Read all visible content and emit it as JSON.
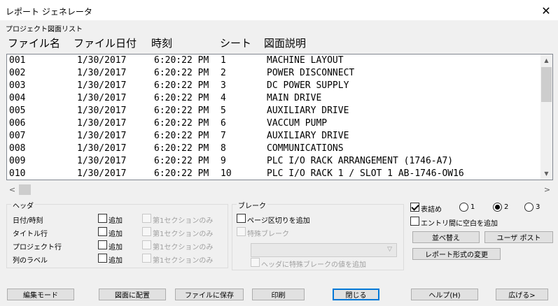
{
  "window": {
    "title": "レポート ジェネレータ",
    "close_glyph": "✕"
  },
  "list": {
    "caption": "プロジェクト図面リスト",
    "columns": {
      "file": "ファイル名",
      "date": "ファイル日付",
      "time": "時刻",
      "sheet": "シート",
      "desc": "図面説明"
    },
    "rows": [
      {
        "file": "001",
        "date": "1/30/2017",
        "time": "6:20:22 PM",
        "sheet": "1",
        "desc": "MACHINE LAYOUT"
      },
      {
        "file": "002",
        "date": "1/30/2017",
        "time": "6:20:22 PM",
        "sheet": "2",
        "desc": "POWER DISCONNECT"
      },
      {
        "file": "003",
        "date": "1/30/2017",
        "time": "6:20:22 PM",
        "sheet": "3",
        "desc": "DC POWER SUPPLY"
      },
      {
        "file": "004",
        "date": "1/30/2017",
        "time": "6:20:22 PM",
        "sheet": "4",
        "desc": "MAIN DRIVE"
      },
      {
        "file": "005",
        "date": "1/30/2017",
        "time": "6:20:22 PM",
        "sheet": "5",
        "desc": "AUXILIARY DRIVE"
      },
      {
        "file": "006",
        "date": "1/30/2017",
        "time": "6:20:22 PM",
        "sheet": "6",
        "desc": "VACCUM PUMP"
      },
      {
        "file": "007",
        "date": "1/30/2017",
        "time": "6:20:22 PM",
        "sheet": "7",
        "desc": "AUXILIARY DRIVE"
      },
      {
        "file": "008",
        "date": "1/30/2017",
        "time": "6:20:22 PM",
        "sheet": "8",
        "desc": "COMMUNICATIONS"
      },
      {
        "file": "009",
        "date": "1/30/2017",
        "time": "6:20:22 PM",
        "sheet": "9",
        "desc": "PLC I/O RACK ARRANGEMENT (1746-A7)"
      },
      {
        "file": "010",
        "date": "1/30/2017",
        "time": "6:20:22 PM",
        "sheet": "10",
        "desc": "PLC I/O RACK 1 / SLOT 1  AB-1746-OW16"
      }
    ]
  },
  "header_group": {
    "legend": "ヘッダ",
    "rows": [
      {
        "label": "日付/時刻",
        "add": "追加",
        "first_only": "第1セクションのみ"
      },
      {
        "label": "タイトル行",
        "add": "追加",
        "first_only": "第1セクションのみ"
      },
      {
        "label": "プロジェクト行",
        "add": "追加",
        "first_only": "第1セクションのみ"
      },
      {
        "label": "列のラベル",
        "add": "追加",
        "first_only": "第1セクションのみ"
      }
    ]
  },
  "break_group": {
    "legend": "ブレーク",
    "page_break": "ページ区切りを追加",
    "special_break": "特殊ブレーク",
    "header_value": "ヘッダに特殊ブレークの値を追加"
  },
  "options": {
    "compact": "表詰め",
    "radio_labels": [
      "1",
      "2",
      "3"
    ],
    "radio_selected": "2",
    "blank_line": "エントリ間に空白を追加",
    "sort": "並べ替え",
    "user_post": "ユーザ ポスト",
    "change_format": "レポート形式の変更"
  },
  "buttons": {
    "edit_mode": "編集モード",
    "place_on_drawing": "図面に配置",
    "save_to_file": "ファイルに保存",
    "print": "印刷",
    "close": "閉じる",
    "help": "ヘルプ(H)",
    "expand": "広げる>"
  }
}
